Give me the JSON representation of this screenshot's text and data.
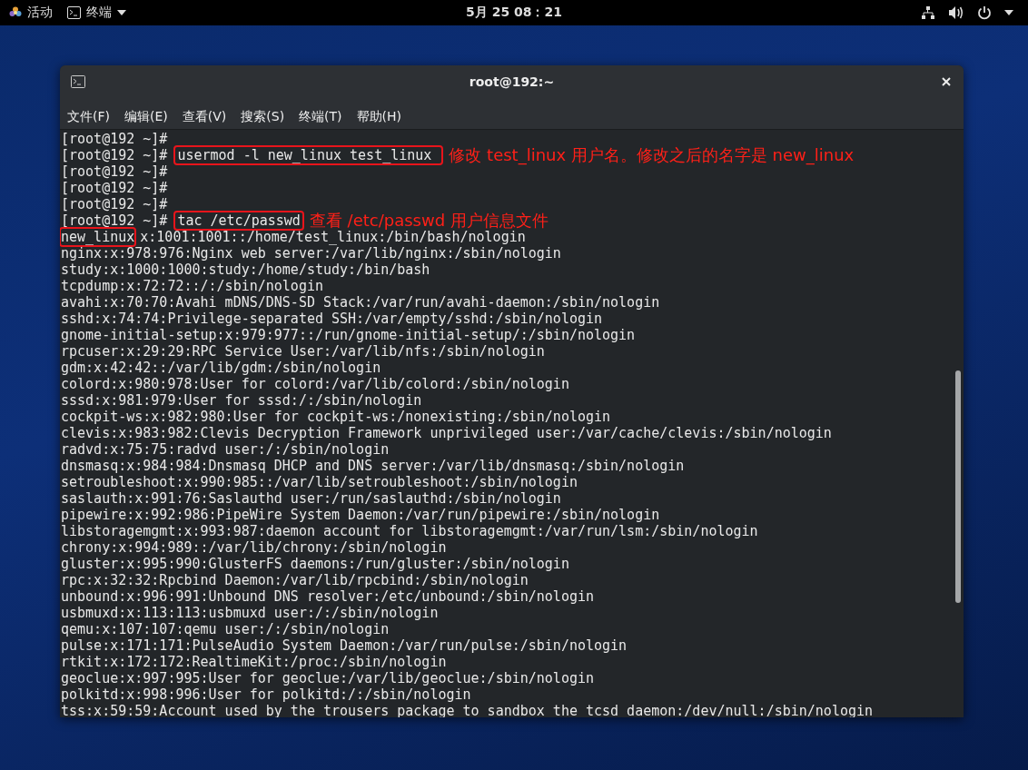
{
  "top_bar": {
    "activities": "活动",
    "app_menu": "终端",
    "clock": "5月 25 08：21"
  },
  "window": {
    "title": "root@192:~"
  },
  "menu": [
    "文件(F)",
    "编辑(E)",
    "查看(V)",
    "搜索(S)",
    "终端(T)",
    "帮助(H)"
  ],
  "lines": [
    {
      "kind": "prompt",
      "prompt": "[root@192 ~]#"
    },
    {
      "kind": "prompt",
      "prompt": "[root@192 ~]#",
      "command": "usermod -l new_linux test_linux ",
      "boxed": true,
      "note": "修改 test_linux 用户名。修改之后的名字是 new_linux"
    },
    {
      "kind": "prompt",
      "prompt": "[root@192 ~]#"
    },
    {
      "kind": "prompt",
      "prompt": "[root@192 ~]#"
    },
    {
      "kind": "prompt",
      "prompt": "[root@192 ~]#"
    },
    {
      "kind": "prompt",
      "prompt": "[root@192 ~]#",
      "command": "tac /etc/passwd",
      "boxed": true,
      "note": "查看 /etc/passwd 用户信息文件"
    },
    {
      "kind": "output",
      "boxed_part": "new_linux",
      "text": "x:1001:1001::/home/test_linux:/bin/bash/nologin"
    },
    {
      "kind": "output",
      "text": "nginx:x:978:976:Nginx web server:/var/lib/nginx:/sbin/nologin"
    },
    {
      "kind": "output",
      "text": "study:x:1000:1000:study:/home/study:/bin/bash"
    },
    {
      "kind": "output",
      "text": "tcpdump:x:72:72::/:/sbin/nologin"
    },
    {
      "kind": "output",
      "text": "avahi:x:70:70:Avahi mDNS/DNS-SD Stack:/var/run/avahi-daemon:/sbin/nologin"
    },
    {
      "kind": "output",
      "text": "sshd:x:74:74:Privilege-separated SSH:/var/empty/sshd:/sbin/nologin"
    },
    {
      "kind": "output",
      "text": "gnome-initial-setup:x:979:977::/run/gnome-initial-setup/:/sbin/nologin"
    },
    {
      "kind": "output",
      "text": "rpcuser:x:29:29:RPC Service User:/var/lib/nfs:/sbin/nologin"
    },
    {
      "kind": "output",
      "text": "gdm:x:42:42::/var/lib/gdm:/sbin/nologin"
    },
    {
      "kind": "output",
      "text": "colord:x:980:978:User for colord:/var/lib/colord:/sbin/nologin"
    },
    {
      "kind": "output",
      "text": "sssd:x:981:979:User for sssd:/:/sbin/nologin"
    },
    {
      "kind": "output",
      "text": "cockpit-ws:x:982:980:User for cockpit-ws:/nonexisting:/sbin/nologin"
    },
    {
      "kind": "output",
      "text": "clevis:x:983:982:Clevis Decryption Framework unprivileged user:/var/cache/clevis:/sbin/nologin"
    },
    {
      "kind": "output",
      "text": "radvd:x:75:75:radvd user:/:/sbin/nologin"
    },
    {
      "kind": "output",
      "text": "dnsmasq:x:984:984:Dnsmasq DHCP and DNS server:/var/lib/dnsmasq:/sbin/nologin"
    },
    {
      "kind": "output",
      "text": "setroubleshoot:x:990:985::/var/lib/setroubleshoot:/sbin/nologin"
    },
    {
      "kind": "output",
      "text": "saslauth:x:991:76:Saslauthd user:/run/saslauthd:/sbin/nologin"
    },
    {
      "kind": "output",
      "text": "pipewire:x:992:986:PipeWire System Daemon:/var/run/pipewire:/sbin/nologin"
    },
    {
      "kind": "output",
      "text": "libstoragemgmt:x:993:987:daemon account for libstoragemgmt:/var/run/lsm:/sbin/nologin"
    },
    {
      "kind": "output",
      "text": "chrony:x:994:989::/var/lib/chrony:/sbin/nologin"
    },
    {
      "kind": "output",
      "text": "gluster:x:995:990:GlusterFS daemons:/run/gluster:/sbin/nologin"
    },
    {
      "kind": "output",
      "text": "rpc:x:32:32:Rpcbind Daemon:/var/lib/rpcbind:/sbin/nologin"
    },
    {
      "kind": "output",
      "text": "unbound:x:996:991:Unbound DNS resolver:/etc/unbound:/sbin/nologin"
    },
    {
      "kind": "output",
      "text": "usbmuxd:x:113:113:usbmuxd user:/:/sbin/nologin"
    },
    {
      "kind": "output",
      "text": "qemu:x:107:107:qemu user:/:/sbin/nologin"
    },
    {
      "kind": "output",
      "text": "pulse:x:171:171:PulseAudio System Daemon:/var/run/pulse:/sbin/nologin"
    },
    {
      "kind": "output",
      "text": "rtkit:x:172:172:RealtimeKit:/proc:/sbin/nologin"
    },
    {
      "kind": "output",
      "text": "geoclue:x:997:995:User for geoclue:/var/lib/geoclue:/sbin/nologin"
    },
    {
      "kind": "output",
      "text": "polkitd:x:998:996:User for polkitd:/:/sbin/nologin"
    },
    {
      "kind": "output",
      "text": "tss:x:59:59:Account used by the trousers package to sandbox the tcsd daemon:/dev/null:/sbin/nologin"
    }
  ]
}
